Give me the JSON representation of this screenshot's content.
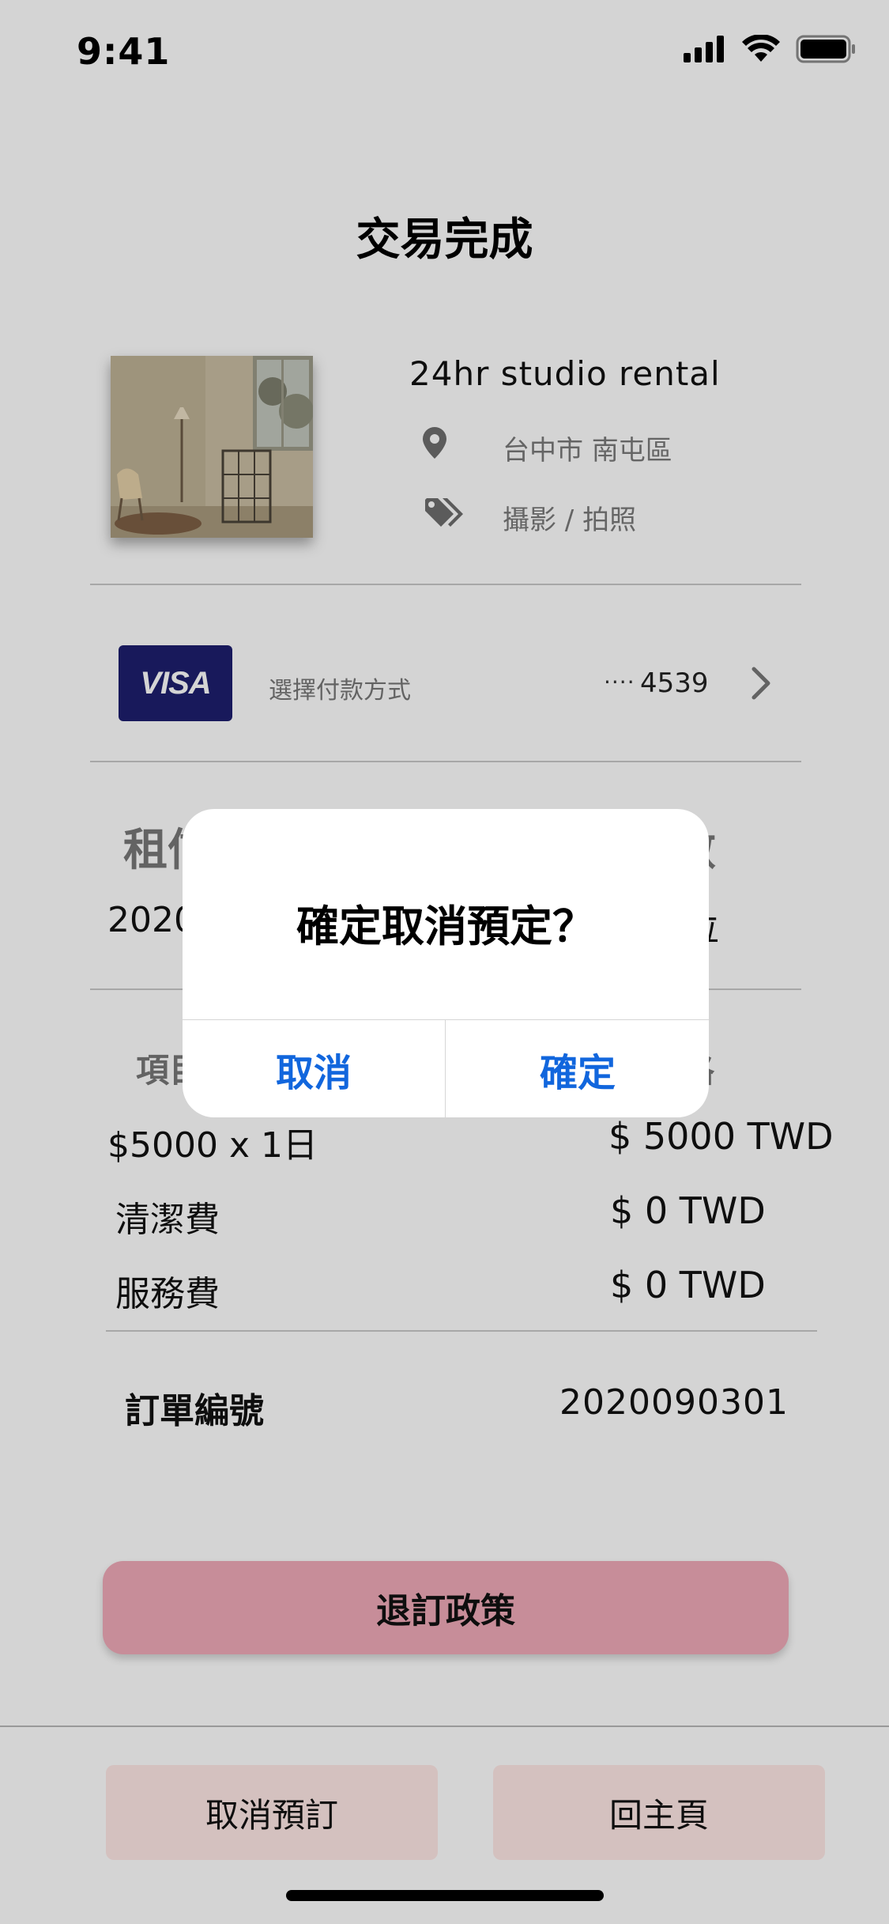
{
  "status_bar": {
    "time": "9:41"
  },
  "header": {
    "title": "交易完成"
  },
  "listing": {
    "name": "24hr studio rental",
    "location": "台中市 南屯區",
    "category": "攝影 / 拍照"
  },
  "payment": {
    "card_brand": "VISA",
    "label": "選擇付款方式",
    "masked_dots": "····",
    "last4": "4539"
  },
  "booking": {
    "date_heading_visible": "租信",
    "guests_heading_visible": "數",
    "date_value_visible": "2020",
    "guests_value_visible": "位"
  },
  "price_table": {
    "item_heading_visible": "項目",
    "price_heading_visible": "格",
    "rows": [
      {
        "label": "$5000 x 1日",
        "value": "$ 5000 TWD"
      },
      {
        "label": "清潔費",
        "value": "$ 0 TWD"
      },
      {
        "label": "服務費",
        "value": "$ 0 TWD"
      }
    ]
  },
  "order": {
    "label": "訂單編號",
    "number": "2020090301"
  },
  "actions": {
    "policy_label": "退訂政策",
    "cancel_booking_label": "取消預訂",
    "home_label": "回主頁"
  },
  "dialog": {
    "title": "確定取消預定？",
    "cancel_label": "取消",
    "confirm_label": "確定"
  },
  "colors": {
    "policy_button": "#f0aab8",
    "bottom_buttons": "#ffe8e6",
    "visa_background": "#1d1f6e",
    "dialog_action": "#1166dd"
  }
}
